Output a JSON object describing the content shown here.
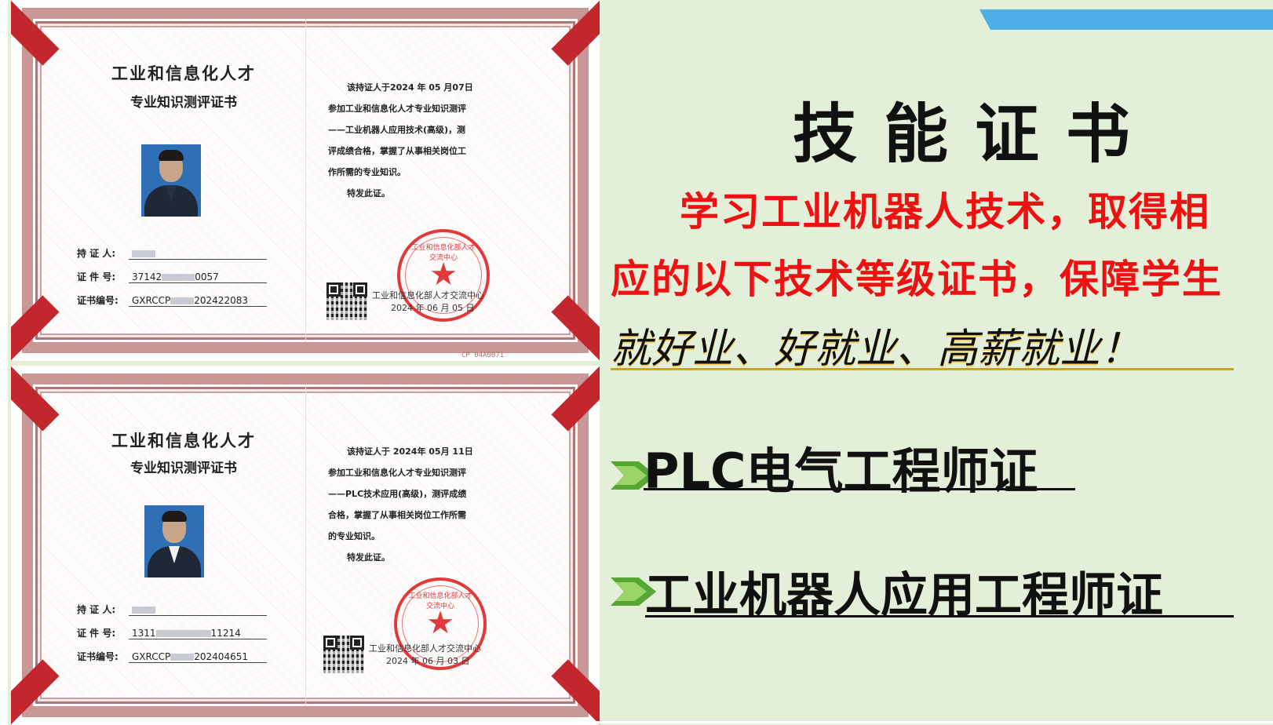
{
  "certificates": [
    {
      "title_line1": "工业和信息化人才",
      "title_line2": "专业知识测评证书",
      "body": {
        "line1": "该持证人于2024 年 05 月07日",
        "line2": "参加工业和信息化人才专业知识测评",
        "line3": "——工业机器人应用技术(高级)，测",
        "line4": "评成绩合格，掌握了从事相关岗位工",
        "line5": "作所需的专业知识。",
        "line6": "特发此证。"
      },
      "holder_label": "持 证 人:",
      "id_label": "证 件 号:",
      "id_prefix": "37142",
      "id_suffix": "0057",
      "cert_no_label": "证书编号:",
      "cert_no_prefix": "GXRCCP",
      "cert_no_suffix": "202422083",
      "issuer": "工业和信息化部人才交流中心",
      "issue_date": "2024 年 06 月 05 日",
      "seal_text": "工业和信息化部人才交流中心",
      "serial": "CP 04A0071"
    },
    {
      "title_line1": "工业和信息化人才",
      "title_line2": "专业知识测评证书",
      "body": {
        "line1": "该持证人于 2024年 05月 11日",
        "line2": "参加工业和信息化人才专业知识测评",
        "line3": "——PLC技术应用(高级)，测评成绩",
        "line4": "合格，掌握了从事相关岗位工作所需",
        "line5": "的专业知识。",
        "line6": "特发此证。"
      },
      "holder_label": "持 证 人:",
      "id_label": "证 件 号:",
      "id_prefix": "1311",
      "id_suffix": "11214",
      "cert_no_label": "证书编号:",
      "cert_no_prefix": "GXRCCP",
      "cert_no_suffix": "202404651",
      "issuer": "工业和信息化部人才交流中心",
      "issue_date": "2024 年 06 月 03 日",
      "seal_text": "工业和信息化部人才交流中心"
    }
  ],
  "panel": {
    "title": "技能证书",
    "desc_line1": "学习工业机器人技术，取得相",
    "desc_line2": "应的以下技术等级证书，保障学生",
    "slogan": "就好业、好就业、高薪就业！",
    "cert_items": [
      "PLC电气工程师证",
      "工业机器人应用工程师证"
    ]
  },
  "colors": {
    "background": "#e3efd9",
    "accent_red": "#ee1111",
    "bullet_green": "#56a633",
    "top_bar_blue": "#4eaee6",
    "seal_red": "#e23a3a",
    "ribbon_red": "#c1272d"
  }
}
